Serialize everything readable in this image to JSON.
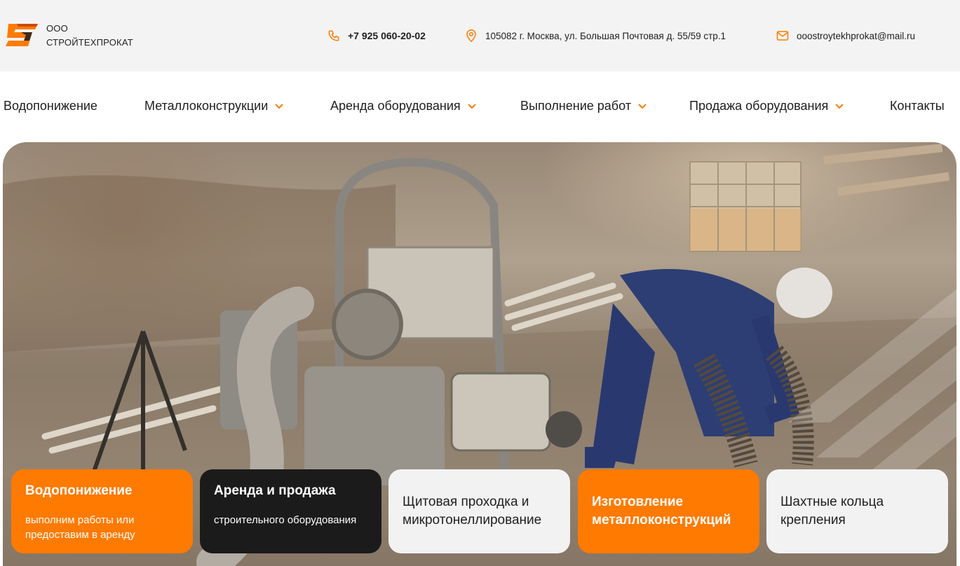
{
  "header": {
    "company_line1": "ООО",
    "company_line2": "СТРОЙТЕХПРОКАТ",
    "phone": "+7 925 060-20-02",
    "address": "105082 г. Москва, ул. Большая Почтовая д. 55/59 стр.1",
    "email": "ooostroytekhprokat@mail.ru"
  },
  "nav": {
    "items": [
      {
        "label": "Водопонижение",
        "has_dropdown": false
      },
      {
        "label": "Металлоконструкции",
        "has_dropdown": true
      },
      {
        "label": "Аренда оборудования",
        "has_dropdown": true
      },
      {
        "label": "Выполнение работ",
        "has_dropdown": true
      },
      {
        "label": "Продажа оборудования",
        "has_dropdown": true
      },
      {
        "label": "Контакты",
        "has_dropdown": false
      }
    ]
  },
  "cards": [
    {
      "title": "Водопонижение",
      "subtitle": "выполним работы или предоставим в аренду",
      "style": "orange"
    },
    {
      "title": "Аренда и продажа",
      "subtitle": "строительного оборудования",
      "style": "dark"
    },
    {
      "title": "Щитовая проходка и микротонеллирование",
      "subtitle": "",
      "style": "light"
    },
    {
      "title": "Изготовление металлоконструкций",
      "subtitle": "",
      "style": "orange"
    },
    {
      "title": "Шахтные кольца крепления",
      "subtitle": "",
      "style": "light"
    }
  ],
  "colors": {
    "accent": "#ff7a00",
    "dark": "#1b1b1b",
    "topbar_bg": "#f3f3f3"
  },
  "icons": {
    "phone": "phone-icon",
    "address": "location-pin-icon",
    "email": "mail-icon",
    "dropdown": "chevron-down-icon"
  }
}
